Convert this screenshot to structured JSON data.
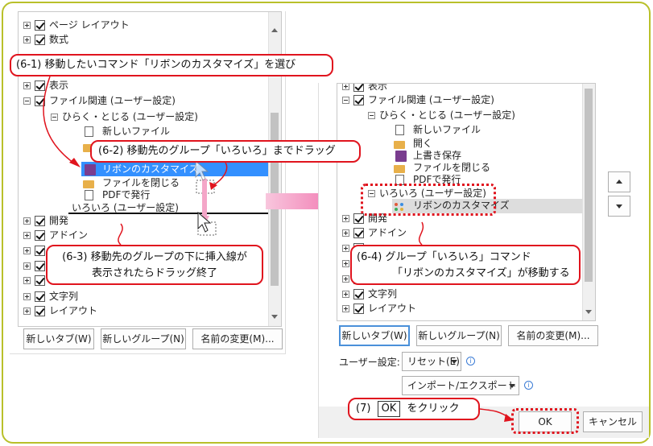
{
  "left_tree": {
    "items": [
      {
        "label": "ページ レイアウト"
      },
      {
        "label": "数式"
      },
      {
        "label": "表示"
      },
      {
        "label": "ファイル関連 (ユーザー設定)"
      },
      {
        "label": "ひらく・とじる (ユーザー設定)"
      },
      {
        "label": "新しいファイル"
      },
      {
        "label": "リボンのカスタマイズ"
      },
      {
        "label": "ファイルを閉じる"
      },
      {
        "label": "PDFで発行"
      },
      {
        "label": "いろいろ (ユーザー設定)"
      },
      {
        "label": "開発"
      },
      {
        "label": "アドイン"
      },
      {
        "label": "文字列"
      },
      {
        "label": "レイアウト"
      }
    ]
  },
  "left_buttons": {
    "new_tab": "新しいタブ(W)",
    "new_group": "新しいグループ(N)",
    "rename": "名前の変更(M)..."
  },
  "right_tree": {
    "items": [
      {
        "label": "表示"
      },
      {
        "label": "ファイル関連 (ユーザー設定)"
      },
      {
        "label": "ひらく・とじる (ユーザー設定)"
      },
      {
        "label": "新しいファイル"
      },
      {
        "label": "開く"
      },
      {
        "label": "上書き保存"
      },
      {
        "label": "ファイルを閉じる"
      },
      {
        "label": "PDFで発行"
      },
      {
        "label": "いろいろ (ユーザー設定)"
      },
      {
        "label": "リボンのカスタマイズ"
      },
      {
        "label": "開発"
      },
      {
        "label": "アドイン"
      },
      {
        "label": "文字列"
      },
      {
        "label": "レイアウト"
      }
    ]
  },
  "right_buttons": {
    "new_tab": "新しいタブ(W)",
    "new_group": "新しいグループ(N)",
    "rename": "名前の変更(M)...",
    "user_settings_label": "ユーザー設定:",
    "reset": "リセット(E)",
    "import_export": "インポート/エクスポート(P)",
    "ok": "OK",
    "cancel": "キャンセル"
  },
  "callouts": {
    "step1": "(6-1) 移動したいコマンド「リボンのカスタマイズ」を選び",
    "step2": "(6-2) 移動先のグループ「いろいろ」までドラッグ",
    "step3_line1": "(6-3) 移動先のグループの下に挿入線が",
    "step3_line2": "表示されたらドラッグ終了",
    "step4_line1": "(6-4) グループ「いろいろ」コマンド",
    "step4_line2": "「リボンのカスタマイズ」が移動する",
    "step5_prefix": "(7)",
    "step5_ok": "OK",
    "step5_suffix": "をクリック"
  },
  "colors": {
    "accent_red": "#e0141e",
    "frame": "#b9c02a",
    "selection": "#3390ff",
    "arrow_pink": "#f06aa8"
  }
}
